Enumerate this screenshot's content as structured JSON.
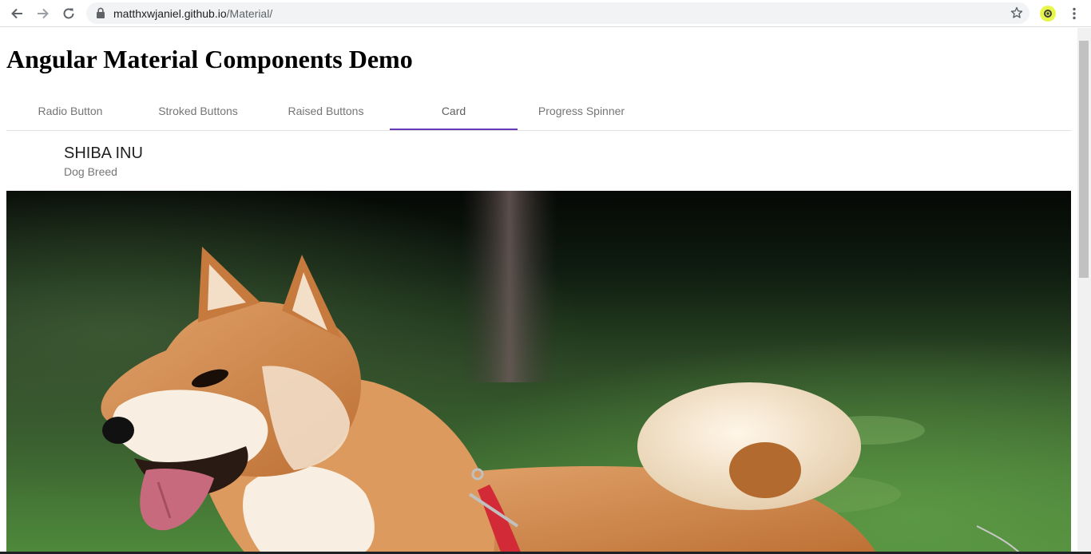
{
  "browser": {
    "url_host": "matthxwjaniel.github.io",
    "url_path": "/Material/"
  },
  "page": {
    "title": "Angular Material Components Demo",
    "tabs": [
      {
        "label": "Radio Button"
      },
      {
        "label": "Stroked Buttons"
      },
      {
        "label": "Raised Buttons"
      },
      {
        "label": "Card",
        "active": true
      },
      {
        "label": "Progress Spinner"
      }
    ],
    "active_tab_color": "#673ab7"
  },
  "card": {
    "title": "SHIBA INU",
    "subtitle": "Dog Breed",
    "image_subject": "shiba-inu-photo"
  }
}
